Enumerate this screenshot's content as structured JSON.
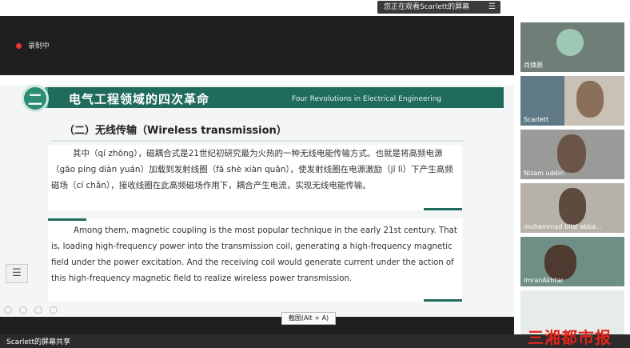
{
  "share_banner": {
    "text": "您正在观看Scarlett的屏幕",
    "menu_icon": "☰"
  },
  "recording": {
    "label": "录制中"
  },
  "slide": {
    "number": "二",
    "title_cn": "电气工程领域的四次革命",
    "title_en": "Four Revolutions in Electrical Engineering",
    "subtitle": "（二）无线传输（Wireless transmission）",
    "paragraph_cn": "其中（qí zhōng），磁耦合式是21世纪初研究最为火热的一种无线电能传输方式。也就是将高频电源（gāo pínɡ diàn yuán）加载到发射线圈（fā shè xiàn quān），使发射线圈在电源激励（jī lì）下产生高频磁场（cí chǎn），接收线圈在此高频磁场作用下，耦合产生电流，实现无线电能传输。",
    "paragraph_en": "Among them, magnetic coupling is the most popular technique in the early 21st century. That is, loading high-frequency power into the transmission coil, generating a high-frequency magnetic field under the power excitation. And the receiving coil would generate current under the action of this high-frequency magnetic field to realize wireless power transmission."
  },
  "tooltip": "截图(Alt + A)",
  "slide_tools": "◯ ◯ ◯ ◯",
  "list_icon": "☰",
  "participants": [
    {
      "name": "肖焕辰",
      "signal": false
    },
    {
      "name": "Scarlett",
      "signal": false
    },
    {
      "name": "Nizam uddin",
      "signal": false
    },
    {
      "name": "muhammad bilal abba...",
      "signal": true
    },
    {
      "name": "ImranAkhtar",
      "signal": true
    },
    {
      "name": "",
      "signal": false
    }
  ],
  "bottom_bar": {
    "text": "Scarlett的屏幕共享"
  },
  "watermark": "三湘都市报",
  "colors": {
    "banner": "#1f6b5c",
    "accent": "#3fa88a",
    "recording": "#e53935",
    "watermark": "#e0241b"
  }
}
